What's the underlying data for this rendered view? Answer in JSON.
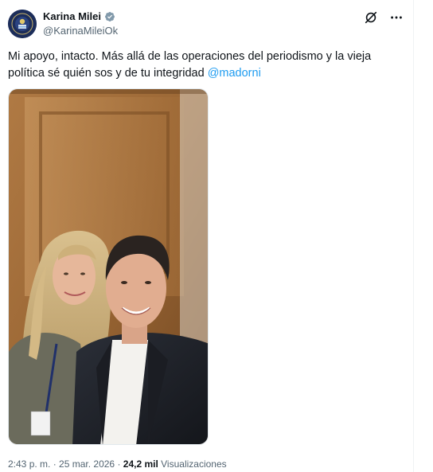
{
  "author": {
    "display_name": "Karina Milei",
    "handle": "@KarinaMileiOk",
    "verified": true
  },
  "post": {
    "text": "Mi apoyo, intacto. Más allá de las operaciones del periodismo y la vieja política sé quién sos y de tu integridad ",
    "mention": "@madorni"
  },
  "meta": {
    "time": "2:43 p. m.",
    "separator1": " · ",
    "date": "25 mar. 2026",
    "separator2": " · ",
    "views_count": "24,2 mil",
    "views_label": " Visualizaciones"
  },
  "icons": {
    "grok": "grok-icon",
    "more": "more-icon",
    "verified": "verified-badge-icon"
  },
  "colors": {
    "link": "#1d9bf0",
    "secondary": "#536471",
    "verified": "#829aab"
  }
}
